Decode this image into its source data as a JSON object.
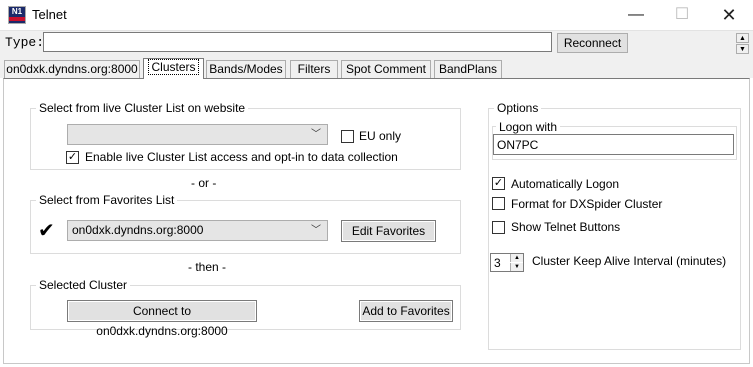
{
  "window": {
    "title": "Telnet",
    "minimize_glyph": "—",
    "maximize_glyph": "☐",
    "close_glyph": "✕"
  },
  "type_row": {
    "label": "Type:",
    "input_value": "",
    "reconnect_label": "Reconnect"
  },
  "tabs": [
    {
      "label": "on0dxk.dyndns.org:8000",
      "active": false
    },
    {
      "label": "Clusters",
      "active": true
    },
    {
      "label": "Bands/Modes",
      "active": false
    },
    {
      "label": "Filters",
      "active": false
    },
    {
      "label": "Spot Comment",
      "active": false
    },
    {
      "label": "BandPlans",
      "active": false
    }
  ],
  "live_list": {
    "title": "Select from live Cluster List on website",
    "combo_value": "",
    "eu_only_label": "EU only",
    "eu_only_checked": false,
    "enable_label": "Enable live Cluster List access and opt-in to data collection",
    "enable_checked": true
  },
  "or_text": "- or -",
  "favorites": {
    "title": "Select from Favorites List",
    "check_glyph": "✔",
    "combo_value": "on0dxk.dyndns.org:8000",
    "edit_label": "Edit Favorites"
  },
  "then_text": "- then -",
  "selected": {
    "title": "Selected Cluster",
    "connect_label": "Connect to on0dxk.dyndns.org:8000",
    "add_label": "Add to Favorites"
  },
  "options": {
    "title": "Options",
    "logon_title": "Logon with",
    "logon_value": "ON7PC",
    "auto_logon_label": "Automatically Logon",
    "auto_logon_checked": true,
    "dxspider_label": "Format for DXSpider Cluster",
    "dxspider_checked": false,
    "telnet_buttons_label": "Show Telnet Buttons",
    "telnet_buttons_checked": false,
    "keepalive_value": "3",
    "keepalive_label": "Cluster Keep Alive Interval (minutes)"
  }
}
